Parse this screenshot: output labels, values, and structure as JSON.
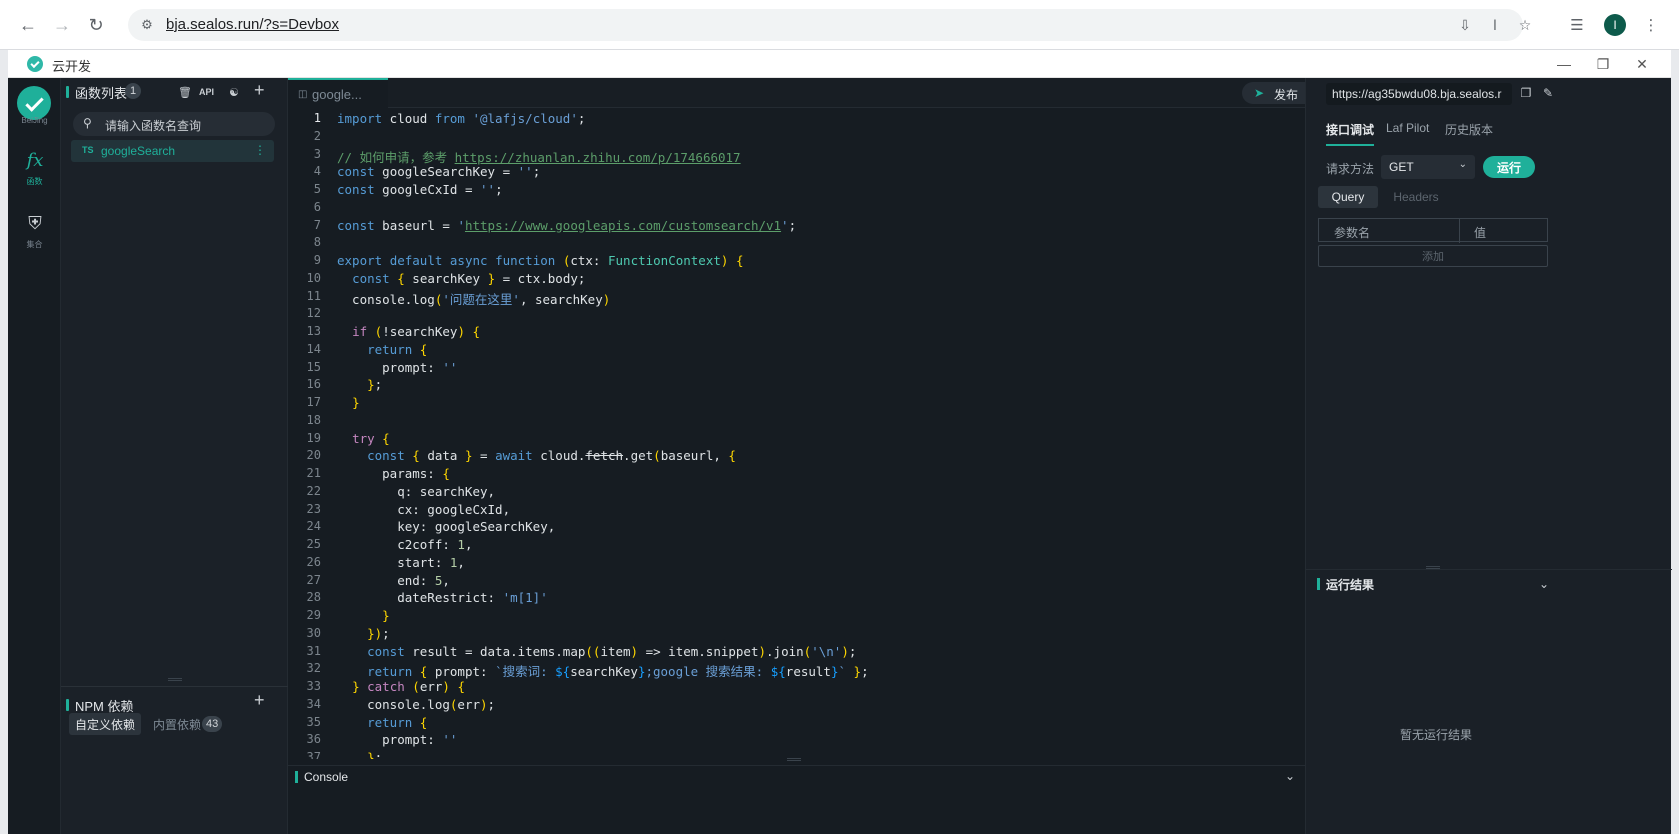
{
  "browser": {
    "url": "bja.sealos.run/?s=Devbox",
    "profile_initial": "I"
  },
  "app": {
    "title": "云开发"
  },
  "rail": {
    "region": "BeiJing",
    "items": [
      {
        "icon": "function-icon",
        "label": "函数"
      },
      {
        "icon": "database-icon",
        "label": "集合"
      }
    ]
  },
  "functions": {
    "title": "函数列表",
    "count": "1",
    "api_label": "API",
    "search_placeholder": "请输入函数名查询",
    "items": [
      {
        "type": "TS",
        "name": "googleSearch"
      }
    ]
  },
  "npm": {
    "title": "NPM 依赖",
    "tab_custom": "自定义依赖",
    "tab_builtin": "内置依赖",
    "builtin_count": "43"
  },
  "editor": {
    "tab_name": "google...",
    "publish_label": "发布",
    "console_label": "Console"
  },
  "code_lines": [
    "import cloud from '@lafjs/cloud';",
    "",
    "// 如何申请，参考 https://zhuanlan.zhihu.com/p/174666017",
    "const googleSearchKey = '';",
    "const googleCxId = '';",
    "",
    "const baseurl = 'https://www.googleapis.com/customsearch/v1';",
    "",
    "export default async function (ctx: FunctionContext) {",
    "  const { searchKey } = ctx.body;",
    "  console.log('问题在这里', searchKey)",
    "",
    "  if (!searchKey) {",
    "    return {",
    "      prompt: ''",
    "    };",
    "  }",
    "",
    "  try {",
    "    const { data } = await cloud.fetch.get(baseurl, {",
    "      params: {",
    "        q: searchKey,",
    "        cx: googleCxId,",
    "        key: googleSearchKey,",
    "        c2coff: 1,",
    "        start: 1,",
    "        end: 5,",
    "        dateRestrict: 'm[1]'",
    "      }",
    "    });",
    "    const result = data.items.map((item) => item.snippet).join('\\n');",
    "    return { prompt: `搜索词: ${searchKey};google 搜索结果: ${result}` };",
    "  } catch (err) {",
    "    console.log(err);",
    "    return {",
    "      prompt: ''",
    "    };"
  ],
  "debug": {
    "function_url": "https://ag35bwdu08.bja.sealos.r",
    "tabs": [
      "接口调试",
      "Laf Pilot",
      "历史版本"
    ],
    "method_label": "请求方法",
    "method_value": "GET",
    "run_label": "运行",
    "query_tab": "Query",
    "headers_tab": "Headers",
    "param_name_header": "参数名",
    "param_value_header": "值",
    "add_label": "添加",
    "result_title": "运行结果",
    "empty_result": "暂无运行结果"
  },
  "colors": {
    "accent": "#1fb09a",
    "editor_bg": "#161c22"
  }
}
